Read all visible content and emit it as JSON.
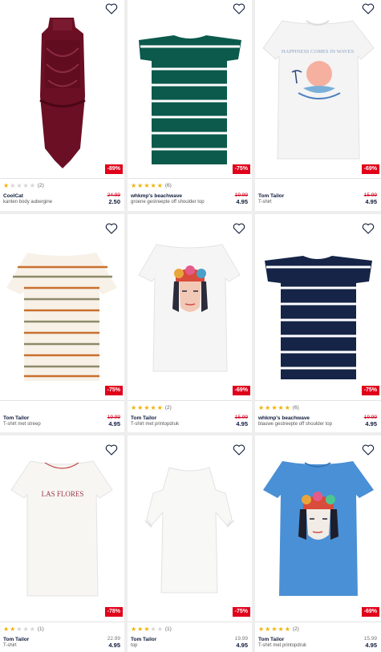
{
  "products": [
    {
      "brand": "CoolCat",
      "desc": "kanten body aubergine",
      "old_price": "24.99",
      "price": "2.50",
      "discount": "-89%",
      "rating": 1,
      "reviews": "(2)"
    },
    {
      "brand": "whkmp's beachwave",
      "desc": "groene gestreepte off shoulder top",
      "old_price": "19.99",
      "price": "4.95",
      "discount": "-75%",
      "rating": 4.5,
      "reviews": "(6)"
    },
    {
      "brand": "Tom Tailor",
      "desc": "T-shirt",
      "old_price": "15.99",
      "price": "4.95",
      "discount": "-69%",
      "rating": 0,
      "reviews": ""
    },
    {
      "brand": "Tom Tailor",
      "desc": "T-shirt met streep",
      "old_price": "19.99",
      "price": "4.95",
      "discount": "-75%",
      "rating": 0,
      "reviews": ""
    },
    {
      "brand": "Tom Tailor",
      "desc": "T-shirt met printopdruk",
      "old_price": "15.99",
      "price": "4.95",
      "discount": "-69%",
      "rating": 5,
      "reviews": "(2)"
    },
    {
      "brand": "whkmp's beachwave",
      "desc": "blauwe gestreepte off shoulder top",
      "old_price": "19.99",
      "price": "4.95",
      "discount": "-75%",
      "rating": 4.5,
      "reviews": "(6)"
    },
    {
      "brand": "Tom Tailor",
      "desc": "T-shirt",
      "old_price": "22.99",
      "price": "4.95",
      "discount": "-78%",
      "rating": 2,
      "reviews": "(1)"
    },
    {
      "brand": "Tom Tailor",
      "desc": "top",
      "old_price": "19.99",
      "price": "4.95",
      "discount": "-75%",
      "rating": 3,
      "reviews": "(1)"
    },
    {
      "brand": "Tom Tailor",
      "desc": "T-shirt met printopdruk",
      "old_price": "15.99",
      "price": "4.95",
      "discount": "-69%",
      "rating": 5,
      "reviews": "(2)"
    }
  ],
  "print_text": {
    "tee_happiness": "HAPPINESS COMES IN WAVES",
    "tee_flores": "LAS FLORES"
  },
  "colors": {
    "accent_red": "#e0001a",
    "star": "#f2b100",
    "brand_text": "#0e1a3b"
  },
  "icons": {
    "wishlist": "heart-outline-icon",
    "star": "star-icon"
  }
}
